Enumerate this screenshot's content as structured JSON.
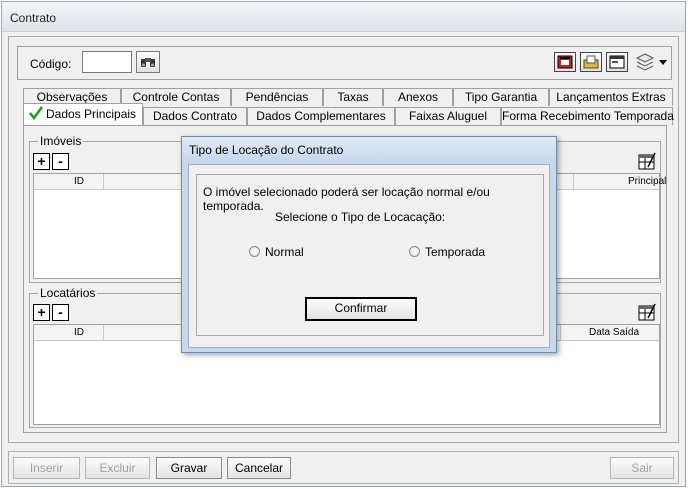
{
  "window": {
    "title": "Contrato"
  },
  "toolbar": {
    "codigo_label": "Código:",
    "codigo_value": ""
  },
  "tabs": {
    "row1": [
      "Observações",
      "Controle Contas",
      "Pendências",
      "Taxas",
      "Anexos",
      "Tipo Garantia",
      "Lançamentos Extras"
    ],
    "row2": [
      "Dados Principais",
      "Dados Contrato",
      "Dados Complementares",
      "Faixas Aluguel",
      "Forma Recebimento Temporada"
    ],
    "active": "Dados Principais"
  },
  "imoveis": {
    "legend": "Imóveis",
    "col_id": "ID",
    "col_principal": "Principal"
  },
  "locatarios": {
    "legend": "Locatários",
    "col_id": "ID",
    "col_data_saida": "Data Saída"
  },
  "add_symbol": "+",
  "remove_symbol": "-",
  "dialog": {
    "title": "Tipo de Locação do Contrato",
    "message": "O imóvel selecionado poderá ser locação normal e/ou temporada.",
    "prompt": "Selecione o Tipo de Locacação:",
    "option_normal": "Normal",
    "option_temporada": "Temporada",
    "confirm_label": "Confirmar"
  },
  "footer": {
    "inserir": "Inserir",
    "excluir": "Excluir",
    "gravar": "Gravar",
    "cancelar": "Cancelar",
    "sair": "Sair"
  },
  "icons": [
    "binoculars-icon",
    "phone-icon",
    "document-folder-icon",
    "window-icon",
    "layers-icon",
    "chevron-down-icon",
    "checkmark-icon",
    "edit-grid-icon"
  ],
  "colors": {
    "check_green": "#1a9a1a",
    "dialog_frame": "#c8d7ea",
    "phone_red": "#c8202a"
  }
}
